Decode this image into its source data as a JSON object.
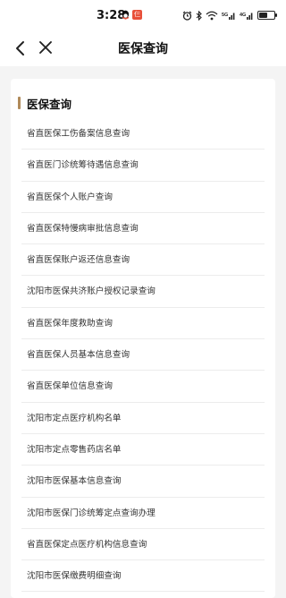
{
  "status_bar": {
    "time": "3:28",
    "notif_badge": "仨",
    "battery_level": 0.55
  },
  "nav": {
    "title": "医保查询",
    "back_icon": "chevron-left-icon",
    "close_icon": "close-icon"
  },
  "section": {
    "title": "医保查询",
    "accent_color": "#b08a5a"
  },
  "items": [
    {
      "label": "省直医保工伤备案信息查询"
    },
    {
      "label": "省直医门诊统筹待遇信息查询"
    },
    {
      "label": "省直医保个人账户查询"
    },
    {
      "label": "省直医保特慢病审批信息查询"
    },
    {
      "label": "省直医保账户返还信息查询"
    },
    {
      "label": "沈阳市医保共济账户授权记录查询"
    },
    {
      "label": "省直医保年度救助查询"
    },
    {
      "label": "省直医保人员基本信息查询"
    },
    {
      "label": "省直医保单位信息查询"
    },
    {
      "label": "沈阳市定点医疗机构名单"
    },
    {
      "label": "沈阳市定点零售药店名单"
    },
    {
      "label": "沈阳市医保基本信息查询"
    },
    {
      "label": "沈阳市医保门诊统筹定点查询办理"
    },
    {
      "label": "省直医保定点医疗机构信息查询"
    },
    {
      "label": "沈阳市医保缴费明细查询"
    }
  ]
}
